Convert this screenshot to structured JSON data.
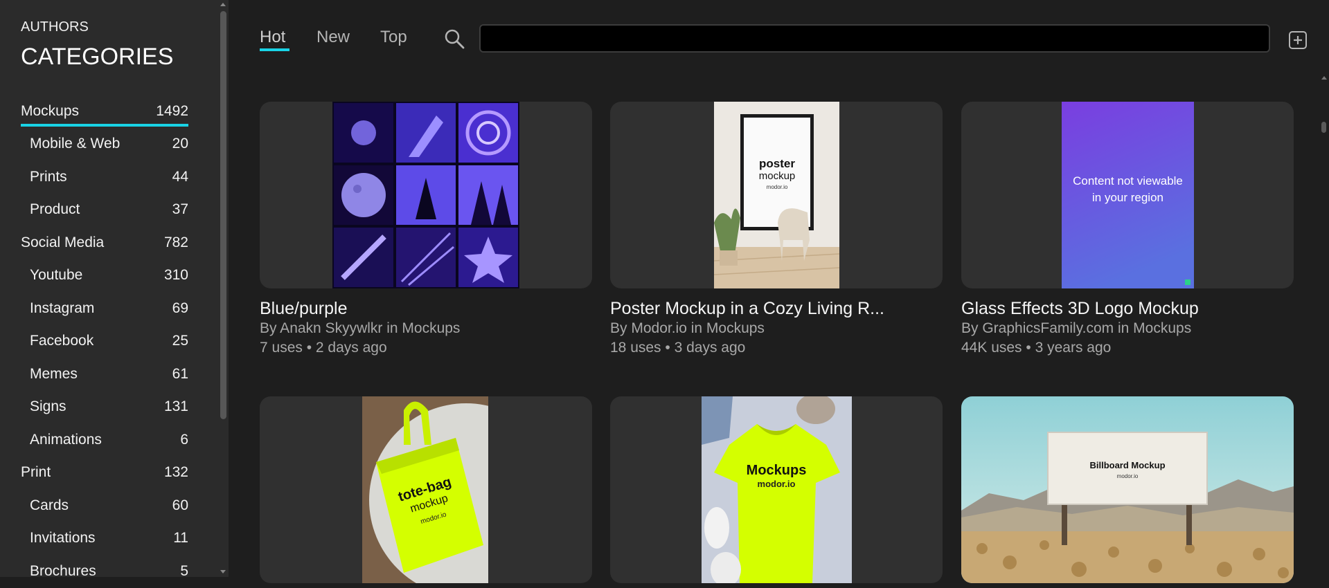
{
  "sidebar": {
    "authors_label": "AUTHORS",
    "heading": "CATEGORIES",
    "categories": [
      {
        "label": "Mockups",
        "count": "1492",
        "sub": false,
        "active": true
      },
      {
        "label": "Mobile & Web",
        "count": "20",
        "sub": true
      },
      {
        "label": "Prints",
        "count": "44",
        "sub": true
      },
      {
        "label": "Product",
        "count": "37",
        "sub": true
      },
      {
        "label": "Social Media",
        "count": "782",
        "sub": false
      },
      {
        "label": "Youtube",
        "count": "310",
        "sub": true
      },
      {
        "label": "Instagram",
        "count": "69",
        "sub": true
      },
      {
        "label": "Facebook",
        "count": "25",
        "sub": true
      },
      {
        "label": "Memes",
        "count": "61",
        "sub": true
      },
      {
        "label": "Signs",
        "count": "131",
        "sub": true
      },
      {
        "label": "Animations",
        "count": "6",
        "sub": true
      },
      {
        "label": "Print",
        "count": "132",
        "sub": false
      },
      {
        "label": "Cards",
        "count": "60",
        "sub": true
      },
      {
        "label": "Invitations",
        "count": "11",
        "sub": true
      },
      {
        "label": "Brochures",
        "count": "5",
        "sub": true
      }
    ]
  },
  "tabs": [
    {
      "label": "Hot",
      "active": true
    },
    {
      "label": "New",
      "active": false
    },
    {
      "label": "Top",
      "active": false
    }
  ],
  "search": {
    "value": "",
    "placeholder": ""
  },
  "icons": {
    "search": "search-icon",
    "add": "plus-square-icon"
  },
  "colors": {
    "accent": "#19d3e6",
    "background": "#1e1e1e",
    "sidebar": "#2b2b2b",
    "card": "#303030"
  },
  "cards": [
    {
      "title": "Blue/purple",
      "meta": "By Anakn Skyywlkr in Mockups",
      "stats": "7 uses • 2 days ago"
    },
    {
      "title": "Poster Mockup in a Cozy Living R...",
      "meta": "By Modor.io in Mockups",
      "stats": "18 uses • 3 days ago",
      "poster_word1": "poster",
      "poster_word2": "mockup",
      "poster_brand": "modor.io"
    },
    {
      "title": "Glass Effects 3D Logo Mockup",
      "meta": "By GraphicsFamily.com in Mockups",
      "stats": "44K uses • 3 years ago",
      "blocked_line1": "Content not viewable",
      "blocked_line2": "in your region"
    },
    {
      "bag_line1": "tote-bag",
      "bag_line2": "mockup",
      "bag_brand": "modor.io"
    },
    {
      "shirt_line1": "Mockups",
      "shirt_brand": "modor.io"
    },
    {
      "billboard_title": "Billboard Mockup",
      "billboard_brand": "modor.io"
    }
  ]
}
